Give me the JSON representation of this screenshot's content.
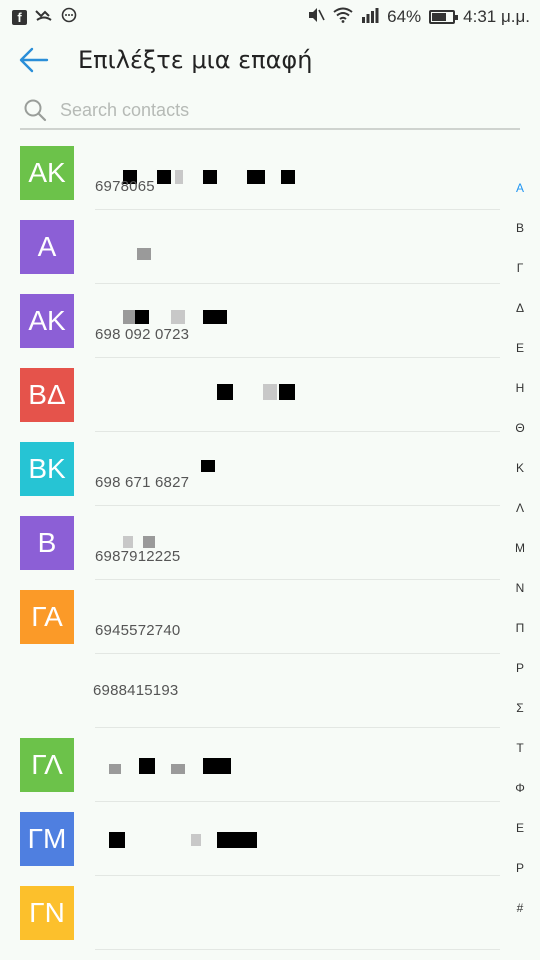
{
  "status_bar": {
    "left_icons": [
      "facebook-icon",
      "missed-call-icon",
      "messenger-icon"
    ],
    "right_icons": [
      "mute-icon",
      "wifi-icon",
      "signal-icon"
    ],
    "battery_percent_label": "64%",
    "battery_level": 0.64,
    "time": "4:31 μ.μ."
  },
  "app_bar": {
    "back_icon": "arrow-left-icon",
    "title": "Επιλέξτε μια επαφή"
  },
  "search": {
    "icon": "search-icon",
    "placeholder": "Search contacts",
    "value": ""
  },
  "contacts": [
    {
      "initials": "ΑΚ",
      "color": "#6cc24a",
      "number": "6978065"
    },
    {
      "initials": "Α",
      "color": "#8c5fd6",
      "number": ""
    },
    {
      "initials": "ΑΚ",
      "color": "#8c5fd6",
      "number": "698 092 0723"
    },
    {
      "initials": "ΒΔ",
      "color": "#e5534b",
      "number": ""
    },
    {
      "initials": "ΒΚ",
      "color": "#26c4d4",
      "number": "698 671 6827"
    },
    {
      "initials": "Β",
      "color": "#8c5fd6",
      "number": "6987912225"
    },
    {
      "initials": "ΓΑ",
      "color": "#fb9a28",
      "number": "6945572740"
    },
    {
      "initials": "",
      "color": "",
      "number": "6988415193"
    },
    {
      "initials": "ΓΛ",
      "color": "#6cc24a",
      "number": ""
    },
    {
      "initials": "ΓΜ",
      "color": "#4f7fe0",
      "number": ""
    },
    {
      "initials": "ΓΝ",
      "color": "#fcc02c",
      "number": ""
    }
  ],
  "alpha_index": {
    "letters": [
      "Α",
      "Β",
      "Γ",
      "Δ",
      "Ε",
      "Η",
      "Θ",
      "Κ",
      "Λ",
      "Μ",
      "Ν",
      "Π",
      "Ρ",
      "Σ",
      "Τ",
      "Φ",
      "Ε",
      "Ρ",
      "#"
    ],
    "active": "Α"
  },
  "colors": {
    "accent": "#2196f3",
    "background": "#f7fbf7"
  }
}
